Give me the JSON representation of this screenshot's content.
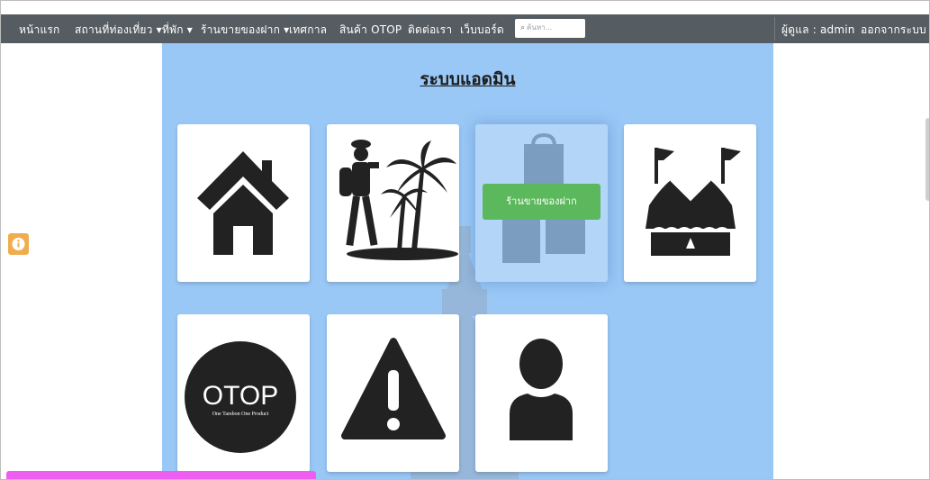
{
  "nav": {
    "items": [
      {
        "label": "หน้าแรก",
        "caret": false
      },
      {
        "label": "สถานที่ท่องเที่ยว",
        "caret": true
      },
      {
        "label": "ที่พัก",
        "caret": true
      },
      {
        "label": "ร้านขายของฝาก",
        "caret": true
      },
      {
        "label": "เทศกาล",
        "caret": false
      },
      {
        "label": "สินค้า OTOP",
        "caret": false
      },
      {
        "label": "ติดต่อเรา",
        "caret": false
      },
      {
        "label": "เว็บบอร์ด",
        "caret": false
      }
    ],
    "search": {
      "placeholder": "ค้นหา...",
      "icon": "search-icon"
    },
    "user_label": "ผู้ดูแล : admin",
    "logout_label": "ออกจากระบบ",
    "bg_color": "#555d62"
  },
  "main": {
    "title": "ระบบแอดมิน",
    "bg_color": "#99c8f6",
    "cards": [
      {
        "id": "home",
        "icon": "home-icon"
      },
      {
        "id": "attractions",
        "icon": "traveler-palm-icon"
      },
      {
        "id": "souvenir-shop",
        "icon": "shopping-bags-icon",
        "label": "ร้านขายของฝาก",
        "hovered": true
      },
      {
        "id": "accommodation",
        "icon": "tent-icon"
      },
      {
        "id": "otop",
        "icon": "otop-logo",
        "logo_text": "OTOP",
        "logo_subtext": "One Tambon One Product"
      },
      {
        "id": "warning",
        "icon": "warning-icon"
      },
      {
        "id": "user",
        "icon": "user-icon"
      }
    ]
  },
  "side": {
    "info_icon": "info-icon",
    "info_color": "#f0ad4e"
  },
  "status_bar": {
    "color": "#ee5ef0"
  }
}
